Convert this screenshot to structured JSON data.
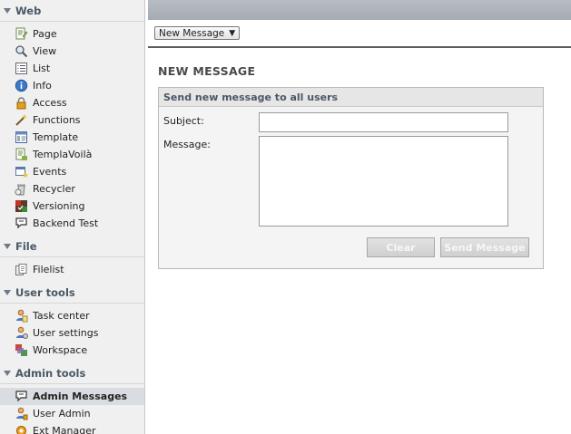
{
  "sidebar": {
    "groups": [
      {
        "title": "Web",
        "items": [
          {
            "label": "Page",
            "icon": "page-icon"
          },
          {
            "label": "View",
            "icon": "magnifier-icon"
          },
          {
            "label": "List",
            "icon": "list-icon"
          },
          {
            "label": "Info",
            "icon": "info-icon"
          },
          {
            "label": "Access",
            "icon": "lock-icon"
          },
          {
            "label": "Functions",
            "icon": "wand-icon"
          },
          {
            "label": "Template",
            "icon": "template-icon"
          },
          {
            "label": "TemplaVoilà",
            "icon": "templavoila-icon"
          },
          {
            "label": "Events",
            "icon": "events-icon"
          },
          {
            "label": "Recycler",
            "icon": "recycler-icon"
          },
          {
            "label": "Versioning",
            "icon": "versioning-icon"
          },
          {
            "label": "Backend Test",
            "icon": "speech-bubble-icon"
          }
        ]
      },
      {
        "title": "File",
        "items": [
          {
            "label": "Filelist",
            "icon": "filelist-icon"
          }
        ]
      },
      {
        "title": "User tools",
        "items": [
          {
            "label": "Task center",
            "icon": "task-center-icon"
          },
          {
            "label": "User settings",
            "icon": "user-settings-icon"
          },
          {
            "label": "Workspace",
            "icon": "workspace-icon"
          }
        ]
      },
      {
        "title": "Admin tools",
        "items": [
          {
            "label": "Admin Messages",
            "icon": "speech-bubble-icon",
            "active": true
          },
          {
            "label": "User Admin",
            "icon": "user-admin-icon"
          },
          {
            "label": "Ext Manager",
            "icon": "ext-manager-icon"
          }
        ]
      }
    ]
  },
  "toolbar": {
    "menu_selected": "New Message",
    "menu_arrow": "▼"
  },
  "main": {
    "page_title": "NEW MESSAGE",
    "panel_title": "Send new message to all users",
    "subject_label": "Subject:",
    "subject_value": "",
    "message_label": "Message:",
    "message_value": "",
    "clear_label": "Clear",
    "send_label": "Send Message"
  },
  "colors": {
    "topbar": "#aeb3ba",
    "sidebar_bg": "#f0f0f0",
    "group_header_text": "#4a5866",
    "active_item_bg": "#d9dde2",
    "disabled_button_text": "#f7f7f7"
  }
}
